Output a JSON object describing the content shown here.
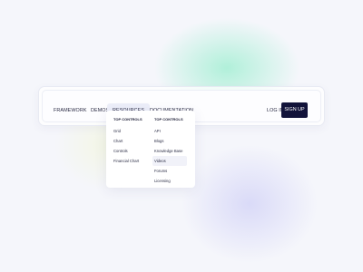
{
  "nav": {
    "items": [
      "FRAMEWORK",
      "DEMOS",
      "RESOURCES",
      "DOCUMENTATION"
    ],
    "login": "LOG IN",
    "signup": "SIGN UP"
  },
  "dropdown": {
    "left": {
      "heading": "TOP CONTROLS",
      "items": [
        "Grid",
        "Chart",
        "Controls",
        "Financial Chart"
      ]
    },
    "right": {
      "heading": "TOP CONTROLS",
      "items": [
        "API",
        "Blogs",
        "Knowledge Base",
        "Videos",
        "Forums",
        "Licensing"
      ],
      "highlighted": "Videos"
    }
  },
  "colors": {
    "background": "#f5f6fb",
    "primary_button": "#12133a",
    "active_tab": "#eceef9"
  }
}
